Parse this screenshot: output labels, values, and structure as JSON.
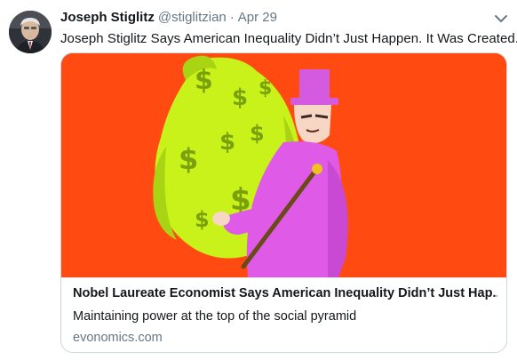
{
  "tweet": {
    "author_name": "Joseph Stiglitz",
    "author_handle": "@stiglitzian",
    "separator": "·",
    "date": "Apr 29",
    "text": "Joseph Stiglitz Says American Inequality Didn’t Just Happen. It Was Created.",
    "avatar_icon": "profile-photo",
    "menu_icon": "chevron-down-icon"
  },
  "card": {
    "title": "Nobel Laureate Economist Says American Inequality Didn’t Just Hap...",
    "description": "Maintaining power at the top of the social pyramid",
    "domain": "evonomics.com",
    "image_background": "#ff4a12",
    "money_bag_color": "#c8f21a",
    "figure_color": "#e05ae8",
    "money_symbol": "$"
  },
  "colors": {
    "text_primary": "#14171a",
    "text_secondary": "#657786",
    "card_border": "#ccd6dd"
  }
}
